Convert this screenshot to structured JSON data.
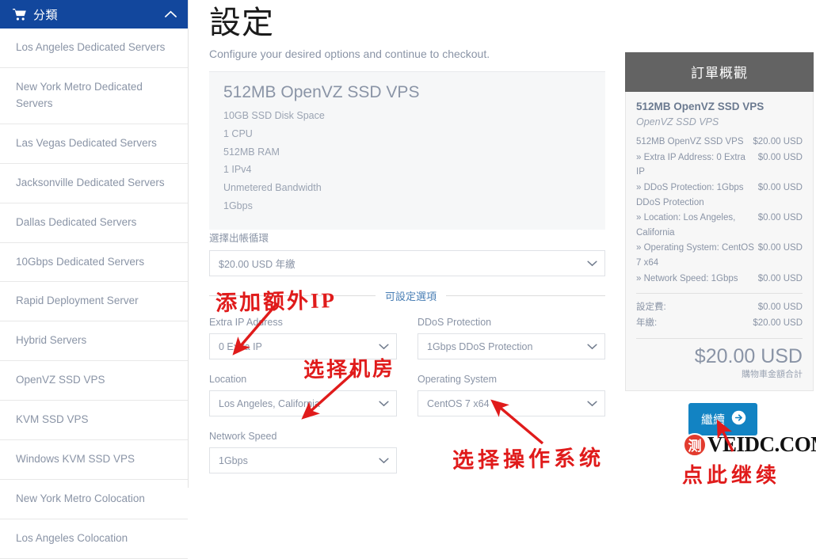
{
  "sidebar": {
    "header": {
      "title": "分類",
      "cart_icon": "shopping-cart-icon",
      "collapse_icon": "chevron-up-icon"
    },
    "items": [
      {
        "label": "Los Angeles Dedicated Servers"
      },
      {
        "label": "New York Metro Dedicated Servers"
      },
      {
        "label": "Las Vegas Dedicated Servers"
      },
      {
        "label": "Jacksonville Dedicated Servers"
      },
      {
        "label": "Dallas Dedicated Servers"
      },
      {
        "label": "10Gbps Dedicated Servers"
      },
      {
        "label": "Rapid Deployment Server"
      },
      {
        "label": "Hybrid Servers"
      },
      {
        "label": "OpenVZ SSD VPS"
      },
      {
        "label": "KVM SSD VPS"
      },
      {
        "label": "Windows KVM SSD VPS"
      },
      {
        "label": "New York Metro Colocation"
      },
      {
        "label": "Los Angeles Colocation"
      }
    ]
  },
  "main": {
    "page_title": "設定",
    "page_subtitle": "Configure your desired options and continue to checkout.",
    "product": {
      "name": "512MB OpenVZ SSD VPS",
      "features": [
        "10GB SSD Disk Space",
        "1 CPU",
        "512MB RAM",
        "1 IPv4",
        "Unmetered Bandwidth",
        "1Gbps"
      ]
    },
    "billing": {
      "label": "選擇出帳循環",
      "value": "$20.00 USD 年繳"
    },
    "configurable_legend": "可設定選項",
    "options": [
      {
        "label": "Extra IP Address",
        "value": "0 Extra IP"
      },
      {
        "label": "DDoS Protection",
        "value": "1Gbps DDoS Protection"
      },
      {
        "label": "Location",
        "value": "Los Angeles, California"
      },
      {
        "label": "Operating System",
        "value": "CentOS 7 x64"
      },
      {
        "label": "Network Speed",
        "value": "1Gbps"
      }
    ]
  },
  "summary": {
    "header": "訂單概觀",
    "product_title": "512MB OpenVZ SSD VPS",
    "product_group": "OpenVZ SSD VPS",
    "lines": [
      {
        "label": "512MB OpenVZ SSD VPS",
        "amount": "$20.00 USD"
      },
      {
        "label": "» Extra IP Address: 0 Extra IP",
        "amount": "$0.00 USD"
      },
      {
        "label": "» DDoS Protection: 1Gbps DDoS Protection",
        "amount": "$0.00 USD"
      },
      {
        "label": "» Location: Los Angeles, California",
        "amount": "$0.00 USD"
      },
      {
        "label": "» Operating System: CentOS 7 x64",
        "amount": "$0.00 USD"
      },
      {
        "label": "» Network Speed: 1Gbps",
        "amount": "$0.00 USD"
      }
    ],
    "totals": [
      {
        "label": "設定費:",
        "amount": "$0.00 USD"
      },
      {
        "label": "年繳:",
        "amount": "$20.00 USD"
      }
    ],
    "grand_total": "$20.00 USD",
    "grand_total_label": "購物車金額合計"
  },
  "continue_button": {
    "label": "繼續",
    "icon": "arrow-right-circle-icon"
  },
  "watermark": {
    "seal_text": "测",
    "site": "VEIDC.COM"
  },
  "annotations": [
    {
      "id": "anno-ip",
      "text": "添加额外IP"
    },
    {
      "id": "anno-room",
      "text": "选择机房"
    },
    {
      "id": "anno-os",
      "text": "选择操作系统"
    },
    {
      "id": "anno-click",
      "text": "点此继续"
    }
  ],
  "colors": {
    "sidebar_header_blue": "#12479d",
    "summary_header_gray": "#636363",
    "continue_blue": "#1283c3",
    "annotation_red": "#e01b1b",
    "muted_text": "#8a94a6"
  }
}
